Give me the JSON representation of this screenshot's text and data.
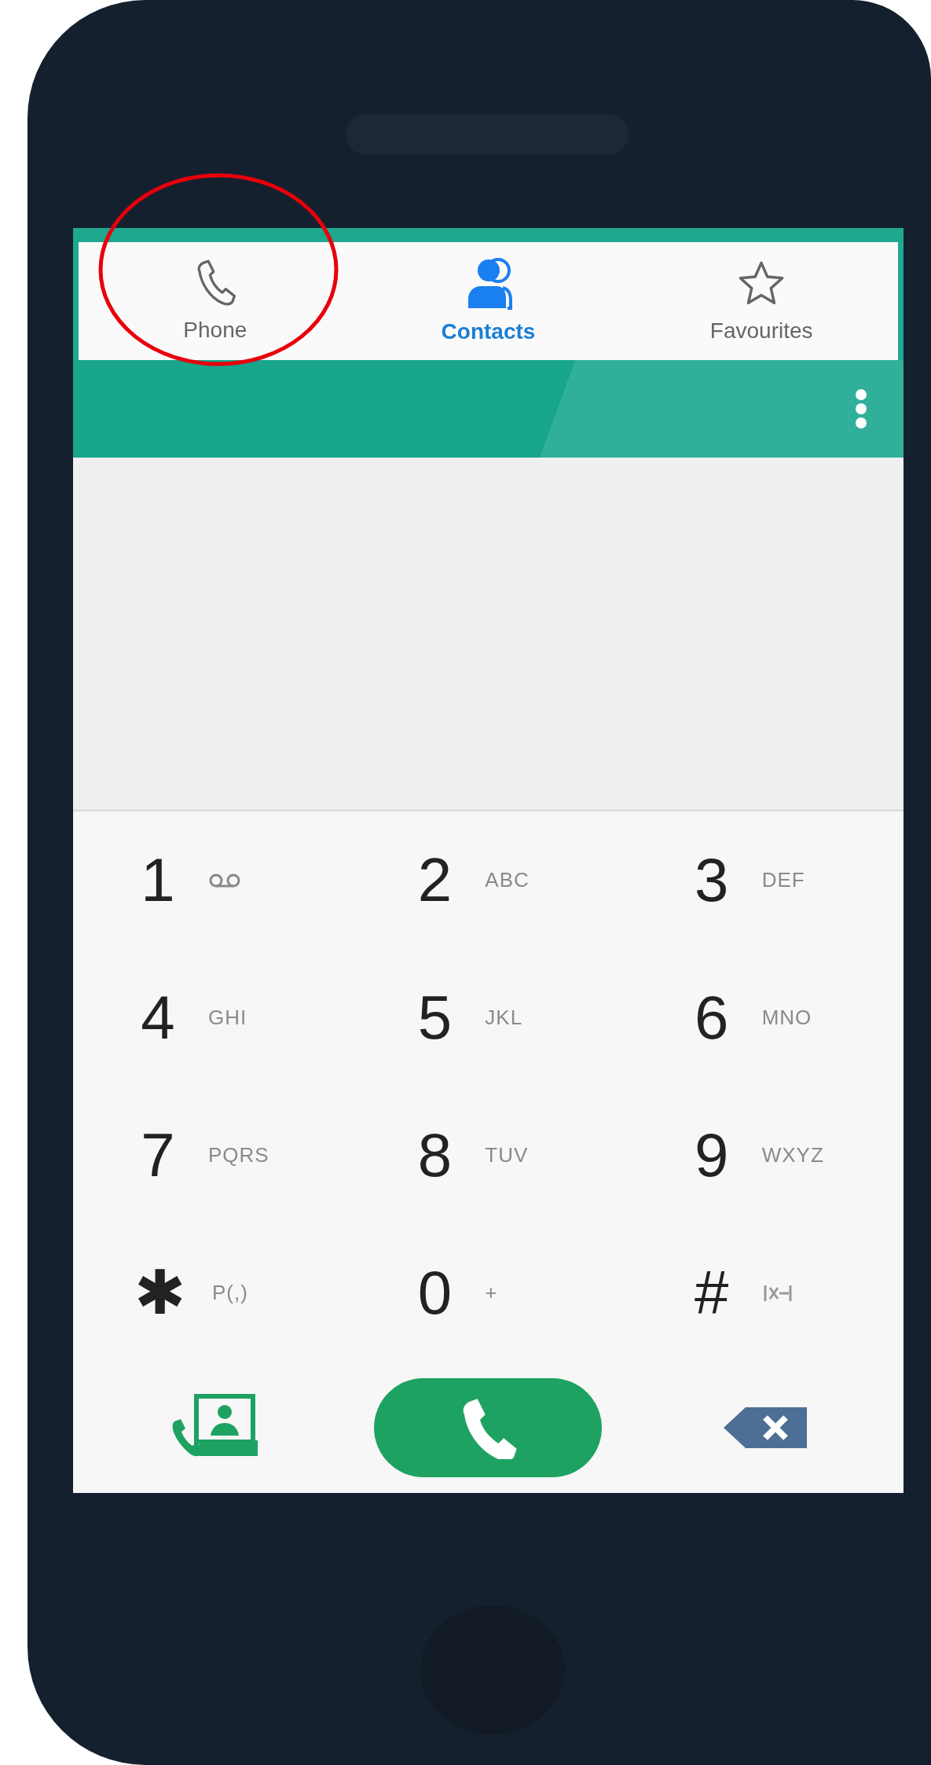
{
  "tabs": [
    {
      "label": "Phone",
      "kind": "phone",
      "selected": false
    },
    {
      "label": "Contacts",
      "kind": "contacts",
      "selected": true
    },
    {
      "label": "Favourites",
      "kind": "favourites",
      "selected": false
    }
  ],
  "keys": [
    {
      "digit": "1",
      "kind": "voicemail"
    },
    {
      "digit": "2",
      "kind": "letters",
      "letters": "ABC"
    },
    {
      "digit": "3",
      "kind": "letters",
      "letters": "DEF"
    },
    {
      "digit": "4",
      "kind": "letters",
      "letters": "GHI"
    },
    {
      "digit": "5",
      "kind": "letters",
      "letters": "JKL"
    },
    {
      "digit": "6",
      "kind": "letters",
      "letters": "MNO"
    },
    {
      "digit": "7",
      "kind": "letters",
      "letters": "PQRS"
    },
    {
      "digit": "8",
      "kind": "letters",
      "letters": "TUV"
    },
    {
      "digit": "9",
      "kind": "letters",
      "letters": "WXYZ"
    },
    {
      "digit": "✱",
      "kind": "letters",
      "letters": "P(,)"
    },
    {
      "digit": "0",
      "kind": "letters",
      "letters": "+"
    },
    {
      "digit": "#",
      "kind": "wait"
    }
  ]
}
